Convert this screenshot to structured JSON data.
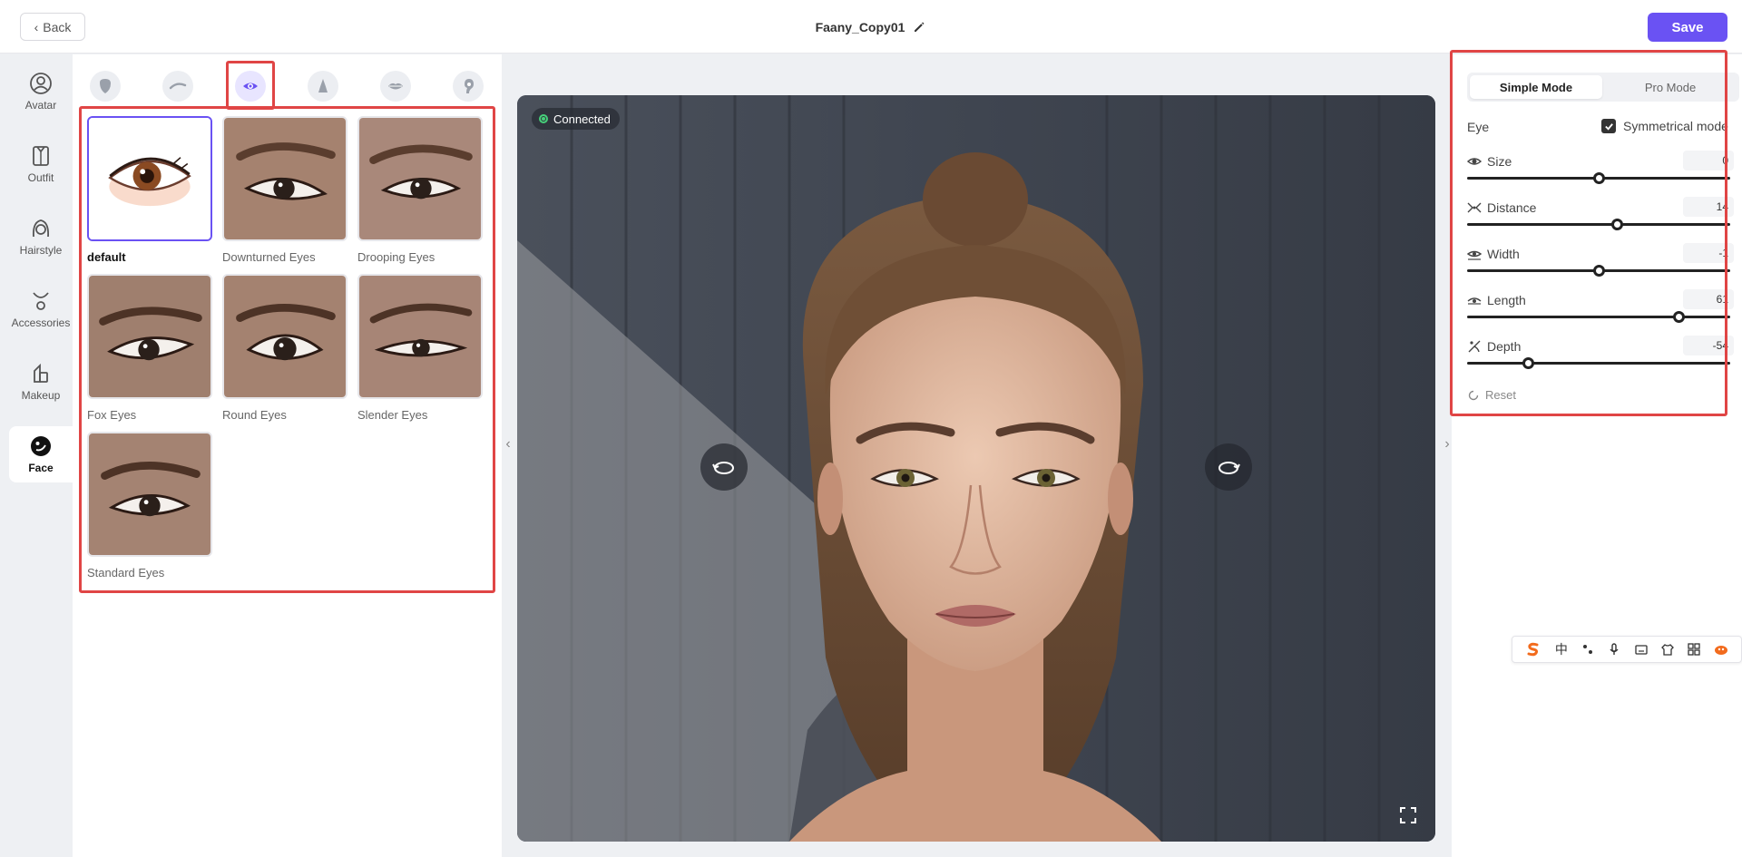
{
  "header": {
    "back_label": "Back",
    "title": "Faany_Copy01",
    "save_label": "Save"
  },
  "left_nav": {
    "items": [
      {
        "label": "Avatar",
        "icon": "avatar-icon"
      },
      {
        "label": "Outfit",
        "icon": "outfit-icon"
      },
      {
        "label": "Hairstyle",
        "icon": "hairstyle-icon"
      },
      {
        "label": "Accessories",
        "icon": "accessories-icon"
      },
      {
        "label": "Makeup",
        "icon": "makeup-icon"
      },
      {
        "label": "Face",
        "icon": "face-icon",
        "active": true
      }
    ]
  },
  "face_categories": [
    {
      "icon": "face-shape-icon"
    },
    {
      "icon": "eyebrow-icon"
    },
    {
      "icon": "eye-icon",
      "active": true
    },
    {
      "icon": "nose-icon"
    },
    {
      "icon": "lips-icon"
    },
    {
      "icon": "ear-icon"
    }
  ],
  "eye_presets": [
    {
      "label": "default",
      "selected": true
    },
    {
      "label": "Downturned Eyes"
    },
    {
      "label": "Drooping Eyes"
    },
    {
      "label": "Fox Eyes"
    },
    {
      "label": "Round Eyes"
    },
    {
      "label": "Slender Eyes"
    },
    {
      "label": "Standard Eyes"
    }
  ],
  "viewport": {
    "status": "Connected",
    "status_color": "#46d07a"
  },
  "right_panel": {
    "tabs": [
      {
        "label": "Simple Mode",
        "active": true
      },
      {
        "label": "Pro Mode"
      }
    ],
    "section_label": "Eye",
    "symmetrical_label": "Symmetrical mode",
    "symmetrical_checked": true,
    "params": [
      {
        "label": "Size",
        "value": "0",
        "level": 0.5,
        "icon": "size-icon"
      },
      {
        "label": "Distance",
        "value": "14",
        "level": 0.57,
        "icon": "distance-icon"
      },
      {
        "label": "Width",
        "value": "-1",
        "level": 0.5,
        "icon": "width-icon"
      },
      {
        "label": "Length",
        "value": "61",
        "level": 0.805,
        "icon": "length-icon"
      },
      {
        "label": "Depth",
        "value": "-54",
        "level": 0.23,
        "icon": "depth-icon"
      }
    ],
    "reset_label": "Reset"
  },
  "ime_toolbar": {
    "chinese_label": "中"
  },
  "colors": {
    "accent": "#6a52f3",
    "highlight": "#e04545"
  }
}
